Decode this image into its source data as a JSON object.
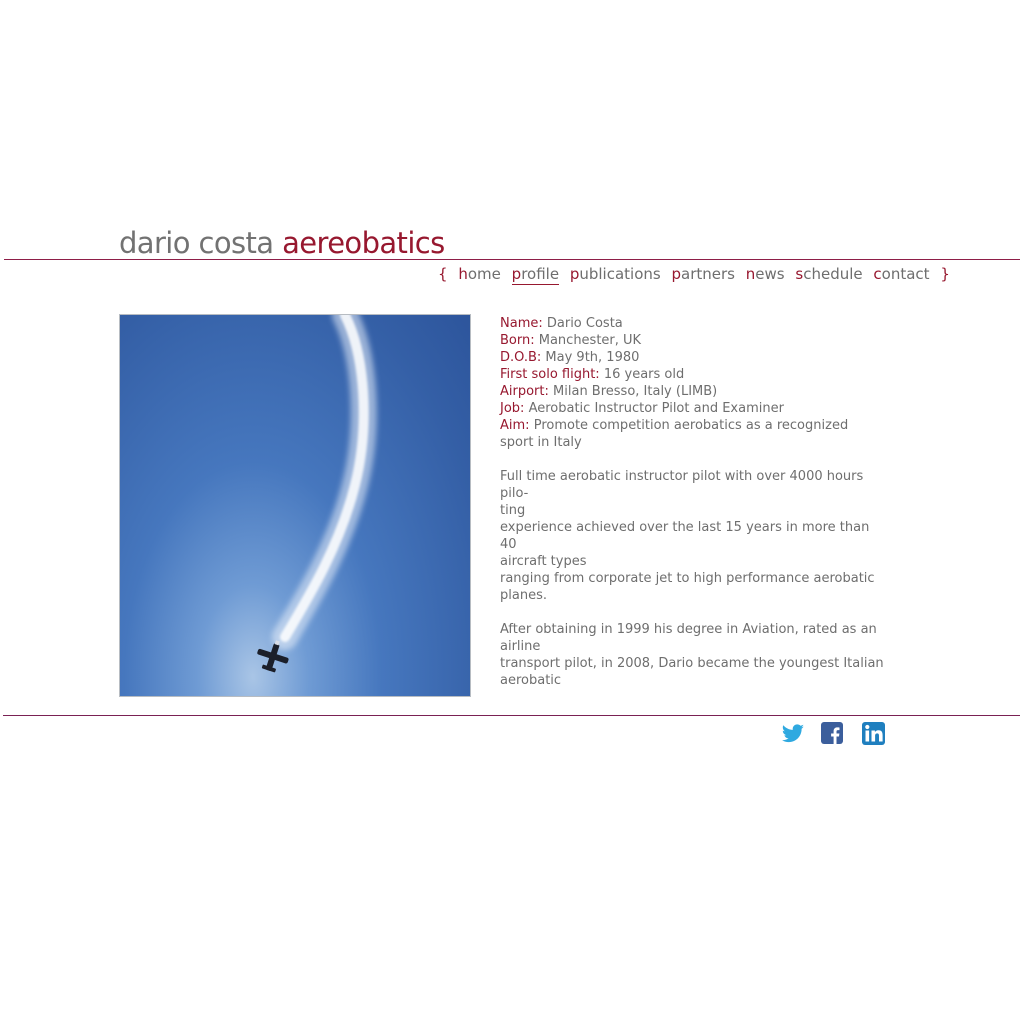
{
  "brand": {
    "name_part1": "dario costa",
    "name_part2": "aereobatics"
  },
  "nav": {
    "open_brace": "{",
    "close_brace": "}",
    "items": [
      {
        "initial": "h",
        "rest": "ome"
      },
      {
        "initial": "p",
        "rest": "rofile",
        "active": true
      },
      {
        "initial": "p",
        "rest": "ublications"
      },
      {
        "initial": "p",
        "rest": "artners"
      },
      {
        "initial": "n",
        "rest": "ews"
      },
      {
        "initial": "s",
        "rest": "chedule"
      },
      {
        "initial": "c",
        "rest": "ontact"
      }
    ]
  },
  "profile": {
    "fields": [
      {
        "label": "Name:",
        "value": "Dario Costa"
      },
      {
        "label": "Born:",
        "value": "Manchester, UK"
      },
      {
        "label": "D.O.B:",
        "value": "May 9th, 1980"
      },
      {
        "label": "First solo flight:",
        "value": "16 years old"
      },
      {
        "label": "Airport:",
        "value": "Milan Bresso, Italy (LIMB)"
      },
      {
        "label": "Job:",
        "value": "Aerobatic Instructor Pilot and Examiner"
      },
      {
        "label": "Aim:",
        "value": "Promote competition aerobatics as a recognized sport in Italy"
      }
    ],
    "paragraph1": [
      "Full time aerobatic instructor pilot with over 4000 hours pilo-",
      "ting",
      "experience achieved over the last 15 years in more than 40",
      "aircraft types",
      "ranging from corporate jet to high performance aerobatic",
      "planes."
    ],
    "paragraph2": [
      "After obtaining in 1999 his degree in Aviation, rated as an",
      "airline",
      "transport pilot, in 2008, Dario became the youngest Italian",
      "aerobatic"
    ]
  },
  "social": {
    "twitter_icon": "twitter-icon",
    "facebook_icon": "facebook-icon",
    "linkedin_icon": "linkedin-icon",
    "twitter_color": "#2fa9e0",
    "facebook_color": "#3b5e9c",
    "linkedin_color": "#1f7fbf"
  },
  "colors": {
    "accent": "#97182f",
    "text": "#6e6e6e",
    "sky": "#3e6db5"
  }
}
